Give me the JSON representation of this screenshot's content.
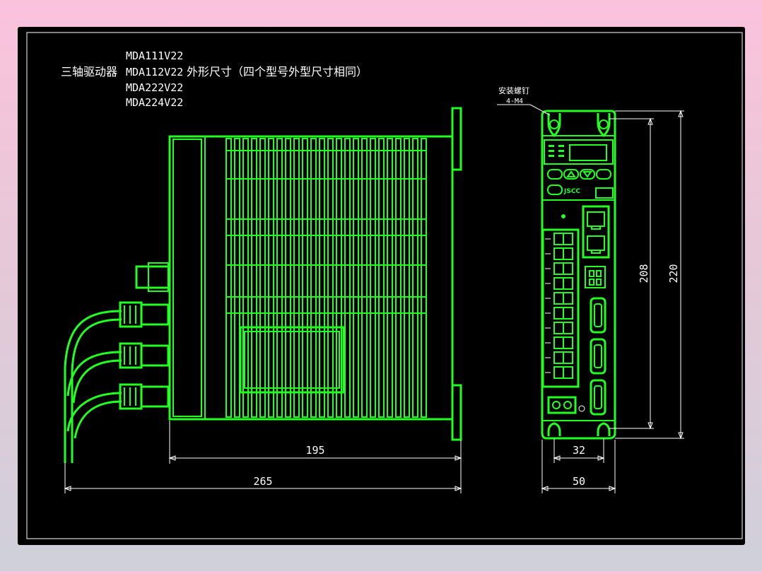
{
  "header": {
    "models": [
      "MDA111V22",
      "MDA112V22",
      "MDA222V22",
      "MDA224V22"
    ],
    "prefix": "三轴驱动器",
    "suffix": "外形尺寸（四个型号外型尺寸相同）"
  },
  "callout": {
    "line1": "安装螺钉",
    "line2": "4-M4"
  },
  "dimensions": {
    "body_length": "195",
    "total_length": "265",
    "hole_spacing": "32",
    "width": "50",
    "hole_height": "208",
    "height": "220"
  },
  "front_panel": {
    "logo": "JSCC"
  },
  "colors": {
    "background": "#000000",
    "drawing": "#22ff22",
    "dimension": "#ffffff"
  }
}
